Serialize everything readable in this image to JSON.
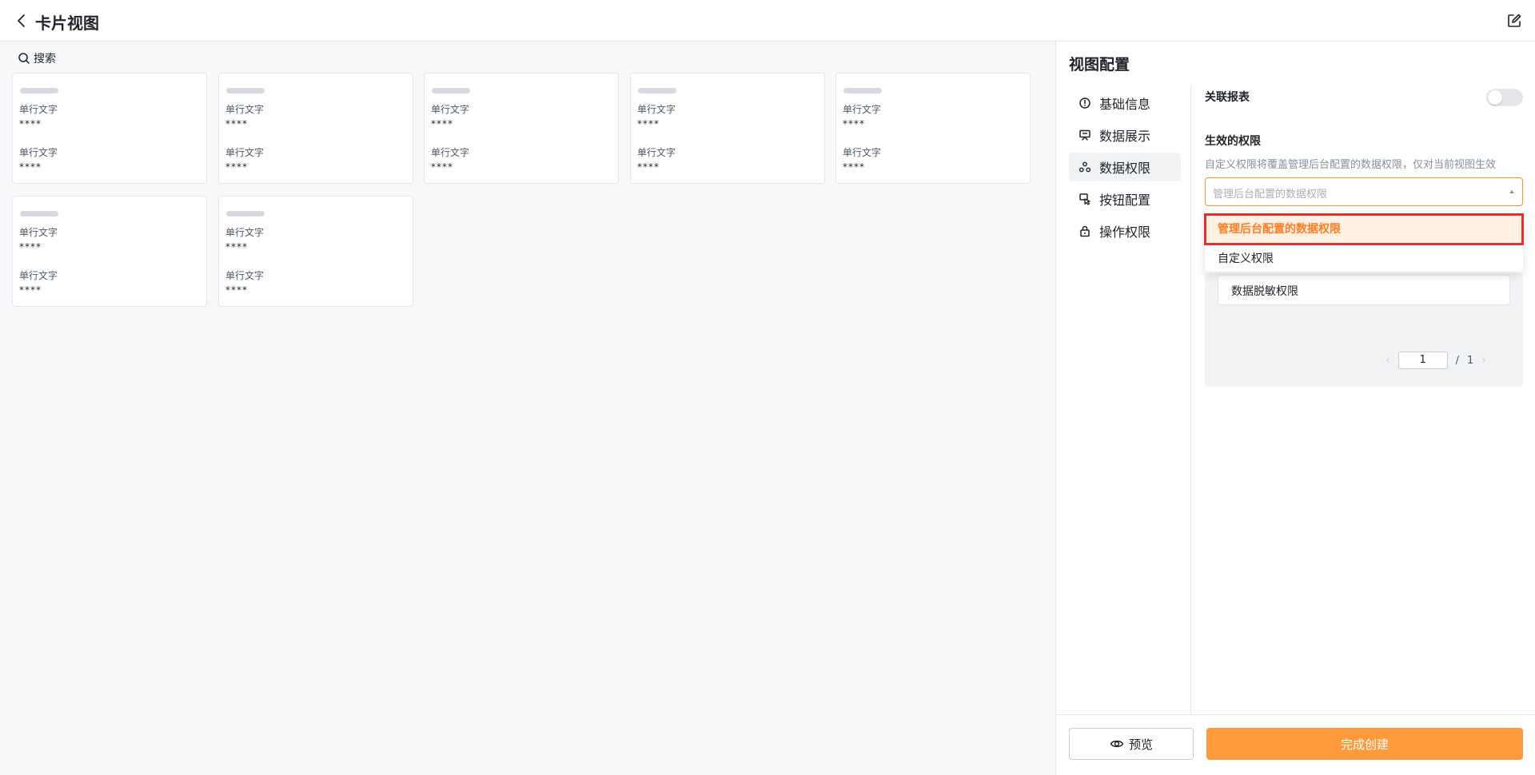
{
  "header": {
    "title": "卡片视图"
  },
  "canvas": {
    "search_label": "搜索",
    "cards": [
      {
        "label1": "单行文字",
        "value1": "****",
        "label2": "单行文字",
        "value2": "****"
      },
      {
        "label1": "单行文字",
        "value1": "****",
        "label2": "单行文字",
        "value2": "****"
      },
      {
        "label1": "单行文字",
        "value1": "****",
        "label2": "单行文字",
        "value2": "****"
      },
      {
        "label1": "单行文字",
        "value1": "****",
        "label2": "单行文字",
        "value2": "****"
      },
      {
        "label1": "单行文字",
        "value1": "****",
        "label2": "单行文字",
        "value2": "****"
      },
      {
        "label1": "单行文字",
        "value1": "****",
        "label2": "单行文字",
        "value2": "****"
      },
      {
        "label1": "单行文字",
        "value1": "****",
        "label2": "单行文字",
        "value2": "****"
      }
    ]
  },
  "panel": {
    "title": "视图配置",
    "nav": [
      {
        "label": "基础信息",
        "icon": "info-icon"
      },
      {
        "label": "数据展示",
        "icon": "display-icon"
      },
      {
        "label": "数据权限",
        "icon": "data-permission-icon",
        "active": true
      },
      {
        "label": "按钮配置",
        "icon": "button-config-icon"
      },
      {
        "label": "操作权限",
        "icon": "lock-icon"
      }
    ],
    "related_report_label": "关联报表",
    "related_report_enabled": false,
    "effective_permission_label": "生效的权限",
    "effective_permission_desc": "自定义权限将覆盖管理后台配置的数据权限，仅对当前视图生效",
    "select_placeholder": "管理后台配置的数据权限",
    "dropdown_options": [
      "管理后台配置的数据权限",
      "自定义权限"
    ],
    "selected_option_index": 0,
    "mask_item_label": "数据脱敏权限",
    "pager": {
      "current": "1",
      "separator": "/",
      "total": "1"
    },
    "footer": {
      "preview_label": "预览",
      "create_label": "完成创建"
    }
  },
  "colors": {
    "accent": "#ff9a3c",
    "selected_text": "#ff7d22",
    "highlight_border": "#e62e2e"
  }
}
